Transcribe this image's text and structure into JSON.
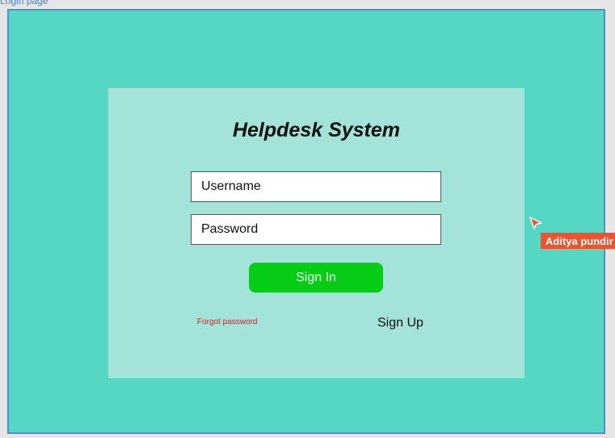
{
  "canvas": {
    "frame_label": "Login page",
    "frame_color": "#56d7c4",
    "frame_border_color": "#4a90d9"
  },
  "login_card": {
    "background": "#a3e3da",
    "title": "Helpdesk System",
    "username": {
      "value": "",
      "placeholder": "Username"
    },
    "password": {
      "value": "",
      "placeholder": "Password"
    },
    "sign_in_label": "Sign In",
    "sign_in_color": "#07cc16",
    "forgot_password_label": "Forgot password",
    "forgot_password_color": "#d0211d",
    "sign_up_label": "Sign Up"
  },
  "collaborator": {
    "name": "Aditya pundir",
    "color": "#f0522f",
    "icon": "pointer-cursor-icon"
  }
}
